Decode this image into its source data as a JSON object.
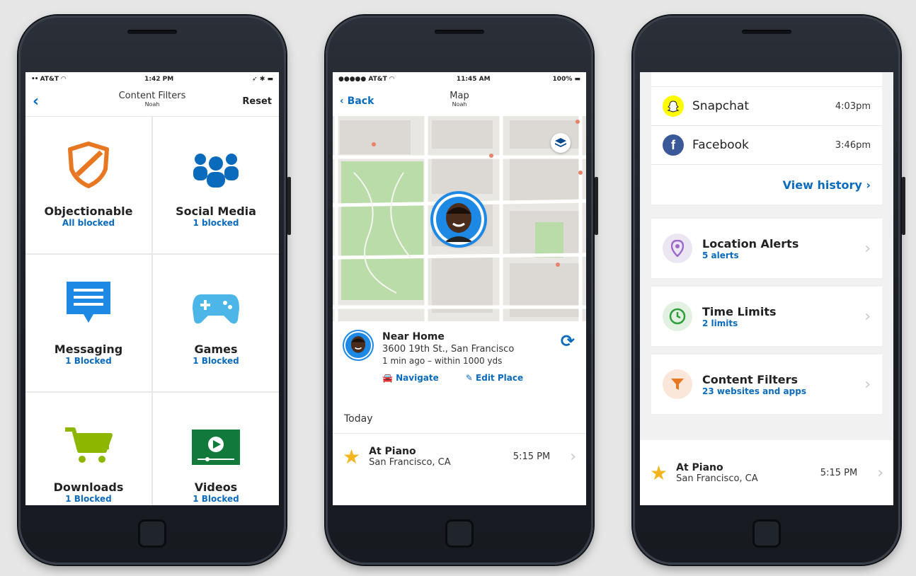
{
  "colors": {
    "accent": "#0a6bbd",
    "orange": "#e87722",
    "green_dark": "#117a3a",
    "lime": "#8db600"
  },
  "phone1": {
    "status": {
      "carrier": "AT&T",
      "time": "1:42 PM"
    },
    "nav": {
      "title": "Content Filters",
      "subtitle": "Noah",
      "right": "Reset"
    },
    "tiles": [
      {
        "title": "Objectionable",
        "sub": "All blocked",
        "icon": "shield-icon"
      },
      {
        "title": "Social Media",
        "sub": "1 blocked",
        "icon": "people-icon"
      },
      {
        "title": "Messaging",
        "sub": "1 Blocked",
        "icon": "message-icon"
      },
      {
        "title": "Games",
        "sub": "1 Blocked",
        "icon": "gamepad-icon"
      },
      {
        "title": "Downloads",
        "sub": "1 Blocked",
        "icon": "cart-icon"
      },
      {
        "title": "Videos",
        "sub": "1 Blocked",
        "icon": "video-icon"
      }
    ]
  },
  "phone2": {
    "status": {
      "carrier": "AT&T",
      "time": "11:45 AM",
      "battery": "100%"
    },
    "nav": {
      "back": "Back",
      "title": "Map",
      "subtitle": "Noah"
    },
    "location": {
      "name": "Near Home",
      "address": "3600 19th St., San Francisco",
      "time": "1 min ago – within 1000 yds",
      "navigate": "Navigate",
      "edit": "Edit Place"
    },
    "section": "Today",
    "event": {
      "title": "At Piano",
      "place": "San Francisco, CA",
      "time": "5:15 PM"
    }
  },
  "phone3": {
    "apps": [
      {
        "name": "Snapchat",
        "time": "4:03pm",
        "icon": "snapchat-icon"
      },
      {
        "name": "Facebook",
        "time": "3:46pm",
        "icon": "facebook-icon"
      }
    ],
    "view_history": "View history",
    "features": [
      {
        "title": "Location Alerts",
        "sub": "5 alerts",
        "icon": "location-pin-icon"
      },
      {
        "title": "Time Limits",
        "sub": "2 limits",
        "icon": "clock-icon"
      },
      {
        "title": "Content Filters",
        "sub": "23 websites and apps",
        "icon": "filter-icon"
      }
    ],
    "event": {
      "title": "At Piano",
      "place": "San Francisco, CA",
      "time": "5:15 PM"
    }
  }
}
